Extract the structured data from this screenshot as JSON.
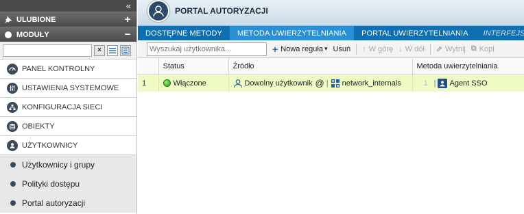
{
  "sidebar": {
    "collapse_glyph": "«",
    "favorites": {
      "label": "ULUBIONE",
      "icon": "pin-icon",
      "action_glyph": "+"
    },
    "modules": {
      "label": "MODUŁY",
      "icon": "circle-icon",
      "action_glyph": "−"
    },
    "search": {
      "value": "",
      "placeholder": "",
      "clear_glyph": "×"
    },
    "menu": [
      {
        "label": "PANEL KONTROLNY",
        "icon": "dashboard-icon"
      },
      {
        "label": "USTAWIENIA SYSTEMOWE",
        "icon": "sliders-icon"
      },
      {
        "label": "KONFIGURACJA SIECI",
        "icon": "network-icon"
      },
      {
        "label": "OBIEKTY",
        "icon": "database-icon"
      },
      {
        "label": "UŻYTKOWNICY",
        "icon": "user-icon"
      }
    ],
    "submenu": [
      {
        "label": "Użytkownicy i grupy"
      },
      {
        "label": "Polityki dostępu"
      },
      {
        "label": "Portal autoryzacji"
      }
    ]
  },
  "page": {
    "title": "PORTAL AUTORYZACJI",
    "icon": "user-icon"
  },
  "tabs": [
    {
      "label": "DOSTĘPNE METODY",
      "state": "normal"
    },
    {
      "label": "METODA UWIERZYTELNIANIA",
      "state": "active"
    },
    {
      "label": "PORTAL UWIERZYTELNIANIA",
      "state": "normal"
    },
    {
      "label": "INTERFEJSY WEWN",
      "state": "disabled"
    }
  ],
  "toolbar": {
    "search_placeholder": "Wyszukaj użytkownika...",
    "new_rule": "Nowa reguła",
    "new_rule_caret": "▾",
    "delete": "Usuń",
    "up": "W górę",
    "down": "W dół",
    "cut": "Wytnij",
    "copy": "Kopi"
  },
  "table": {
    "columns": [
      "",
      "Status",
      "Źródło",
      "Metoda uwierzytelniania"
    ],
    "rows": [
      {
        "index": "1",
        "status": "Włączone",
        "source_user": "Dowolny użytkownik",
        "source_at": "@",
        "source_pipe": "|",
        "source_network": "network_internals",
        "method_index": "1",
        "method_pipe": "|",
        "method": "Agent SSO"
      }
    ]
  },
  "colors": {
    "tab_bar": "#0f6fb0",
    "tab_active": "#2b8fd6",
    "row_enabled": "#eefbc5",
    "status_ok": "#2a9a14",
    "sidebar_header": "#4b4b4b"
  }
}
